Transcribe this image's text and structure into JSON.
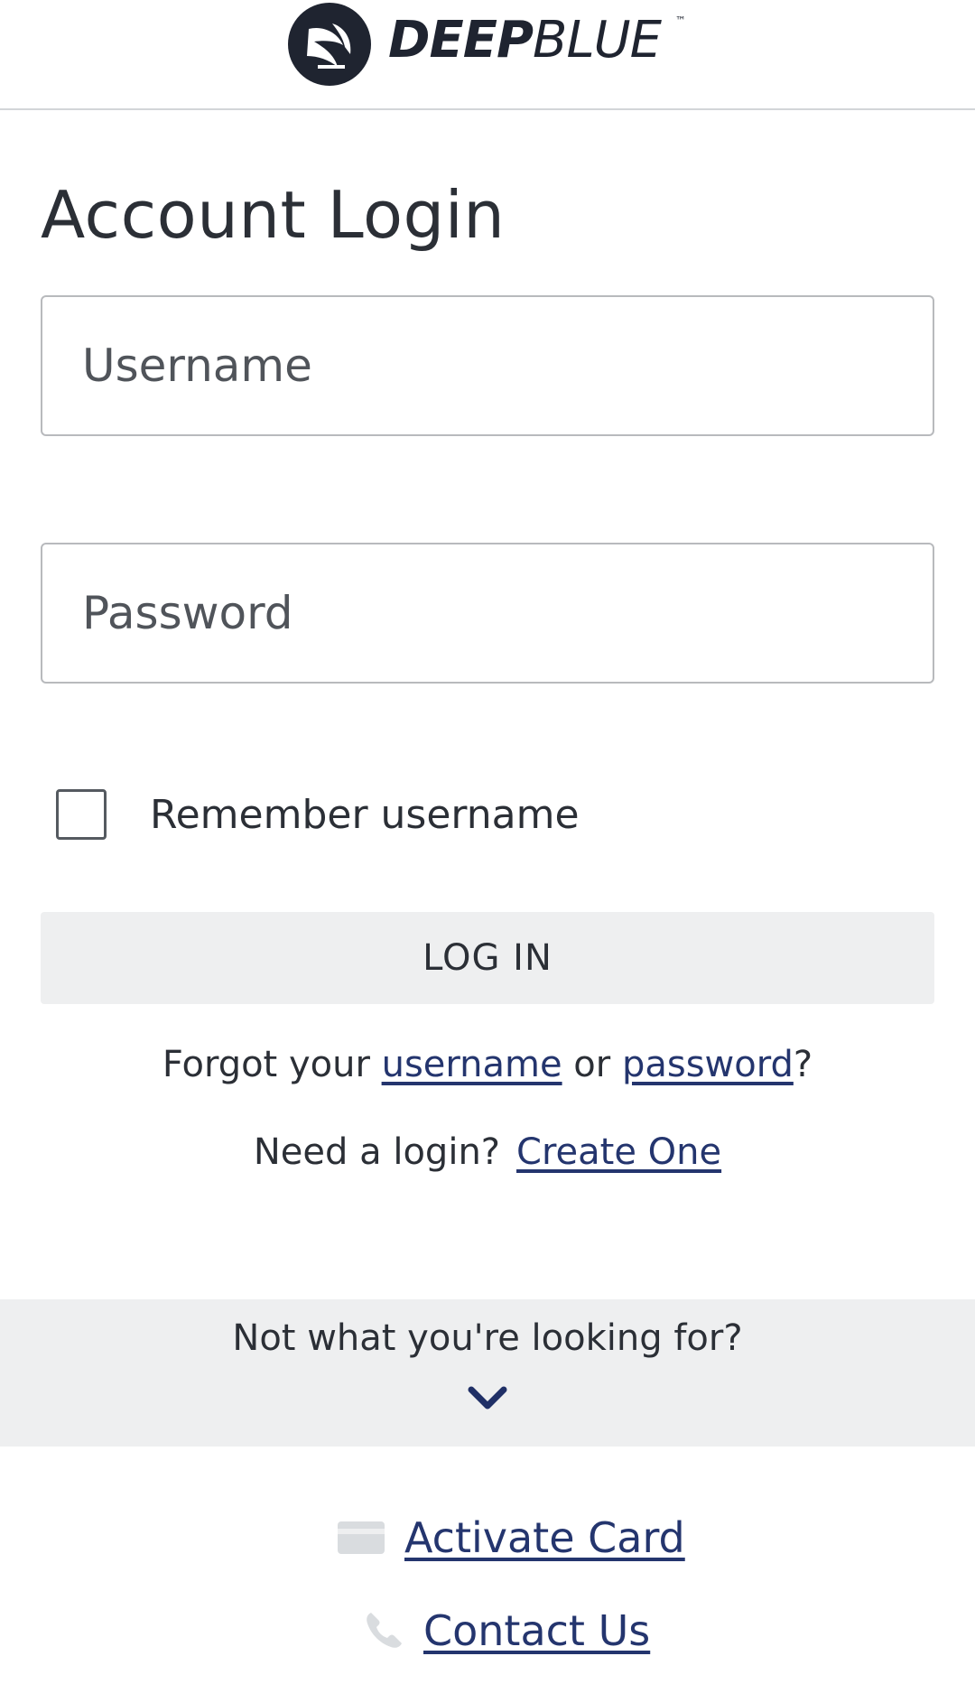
{
  "header": {
    "brand_bold": "DEEP",
    "brand_light": "BLUE",
    "trademark": "™",
    "logo_icon": "deepblue-logo-icon"
  },
  "login": {
    "title": "Account Login",
    "username_placeholder": "Username",
    "password_placeholder": "Password",
    "remember_label": "Remember username",
    "remember_checked": false,
    "login_button": "LOG IN"
  },
  "recovery": {
    "forgot_prefix": "Forgot your ",
    "username_link": "username",
    "or_text": " or ",
    "password_link": "password",
    "forgot_suffix": "?",
    "need_text": "Need a login?",
    "create_link": "Create One"
  },
  "help": {
    "text": "Not what you're looking for?",
    "icon": "chevron-down-icon"
  },
  "footer": {
    "activate_card": "Activate Card",
    "activate_icon": "credit-card-icon",
    "contact_us": "Contact Us",
    "contact_icon": "phone-icon"
  },
  "colors": {
    "link": "#24356e",
    "text": "#2b2f36",
    "band": "#eeeff0",
    "chevron": "#1f2f66"
  }
}
